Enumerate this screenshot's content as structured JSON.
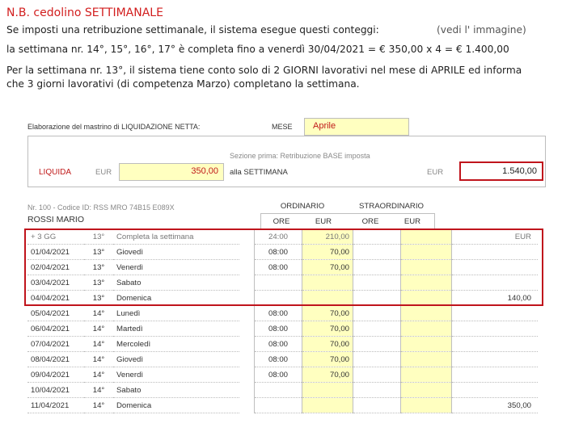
{
  "note": {
    "title": "N.B. cedolino SETTIMANALE",
    "line1": "Se imposti una retribuzione settimanale, il sistema esegue questi conteggi:",
    "line1_link": "(vedi l' immagine)",
    "line2": "la settimana nr. 14°, 15°, 16°, 17° è completa fino a venerdì 30/04/2021 = € 350,00 x 4 = € 1.400,00",
    "line3": "Per la settimana nr. 13°, il sistema tiene conto solo di 2 GIORNI lavorativi nel mese di APRILE ed informa",
    "line4": "che 3 giorni lavorativi (di competenza Marzo) completano la settimana."
  },
  "panel": {
    "header_label": "Elaborazione del mastrino di LIQUIDAZIONE NETTA:",
    "mese_label": "MESE",
    "mese_value": "Aprile",
    "section_label": "Sezione prima: Retribuzione BASE imposta",
    "liquida_label": "LIQUIDA",
    "eur_label": "EUR",
    "base_amount": "350,00",
    "per_label": "alla SETTIMANA",
    "eur_label2": "EUR",
    "total_amount": "1.540,00",
    "employee_code": "Nr. 100 - Codice ID: RSS MRO 74B15 E089X",
    "employee_name": "ROSSI MARIO",
    "hdr_ordinario": "ORDINARIO",
    "hdr_straordinario": "STRAORDINARIO",
    "hdr_ore": "ORE",
    "hdr_eur": "EUR",
    "hdr_ore2": "ORE",
    "hdr_eur2": "EUR"
  },
  "rows": [
    {
      "date": "+ 3 GG",
      "week": "13°",
      "day": "Completa la settimana",
      "ore": "24:00",
      "eur": "210,00",
      "sore": "",
      "seur": "",
      "tot": "EUR"
    },
    {
      "date": "01/04/2021",
      "week": "13°",
      "day": "Giovedì",
      "ore": "08:00",
      "eur": "70,00",
      "sore": "",
      "seur": "",
      "tot": ""
    },
    {
      "date": "02/04/2021",
      "week": "13°",
      "day": "Venerdì",
      "ore": "08:00",
      "eur": "70,00",
      "sore": "",
      "seur": "",
      "tot": ""
    },
    {
      "date": "03/04/2021",
      "week": "13°",
      "day": "Sabato",
      "ore": "",
      "eur": "",
      "sore": "",
      "seur": "",
      "tot": ""
    },
    {
      "date": "04/04/2021",
      "week": "13°",
      "day": "Domenica",
      "ore": "",
      "eur": "",
      "sore": "",
      "seur": "",
      "tot": "140,00"
    },
    {
      "date": "05/04/2021",
      "week": "14°",
      "day": "Lunedì",
      "ore": "08:00",
      "eur": "70,00",
      "sore": "",
      "seur": "",
      "tot": ""
    },
    {
      "date": "06/04/2021",
      "week": "14°",
      "day": "Martedì",
      "ore": "08:00",
      "eur": "70,00",
      "sore": "",
      "seur": "",
      "tot": ""
    },
    {
      "date": "07/04/2021",
      "week": "14°",
      "day": "Mercoledì",
      "ore": "08:00",
      "eur": "70,00",
      "sore": "",
      "seur": "",
      "tot": ""
    },
    {
      "date": "08/04/2021",
      "week": "14°",
      "day": "Giovedì",
      "ore": "08:00",
      "eur": "70,00",
      "sore": "",
      "seur": "",
      "tot": ""
    },
    {
      "date": "09/04/2021",
      "week": "14°",
      "day": "Venerdì",
      "ore": "08:00",
      "eur": "70,00",
      "sore": "",
      "seur": "",
      "tot": ""
    },
    {
      "date": "10/04/2021",
      "week": "14°",
      "day": "Sabato",
      "ore": "",
      "eur": "",
      "sore": "",
      "seur": "",
      "tot": ""
    },
    {
      "date": "11/04/2021",
      "week": "14°",
      "day": "Domenica",
      "ore": "",
      "eur": "",
      "sore": "",
      "seur": "",
      "tot": "350,00"
    }
  ]
}
